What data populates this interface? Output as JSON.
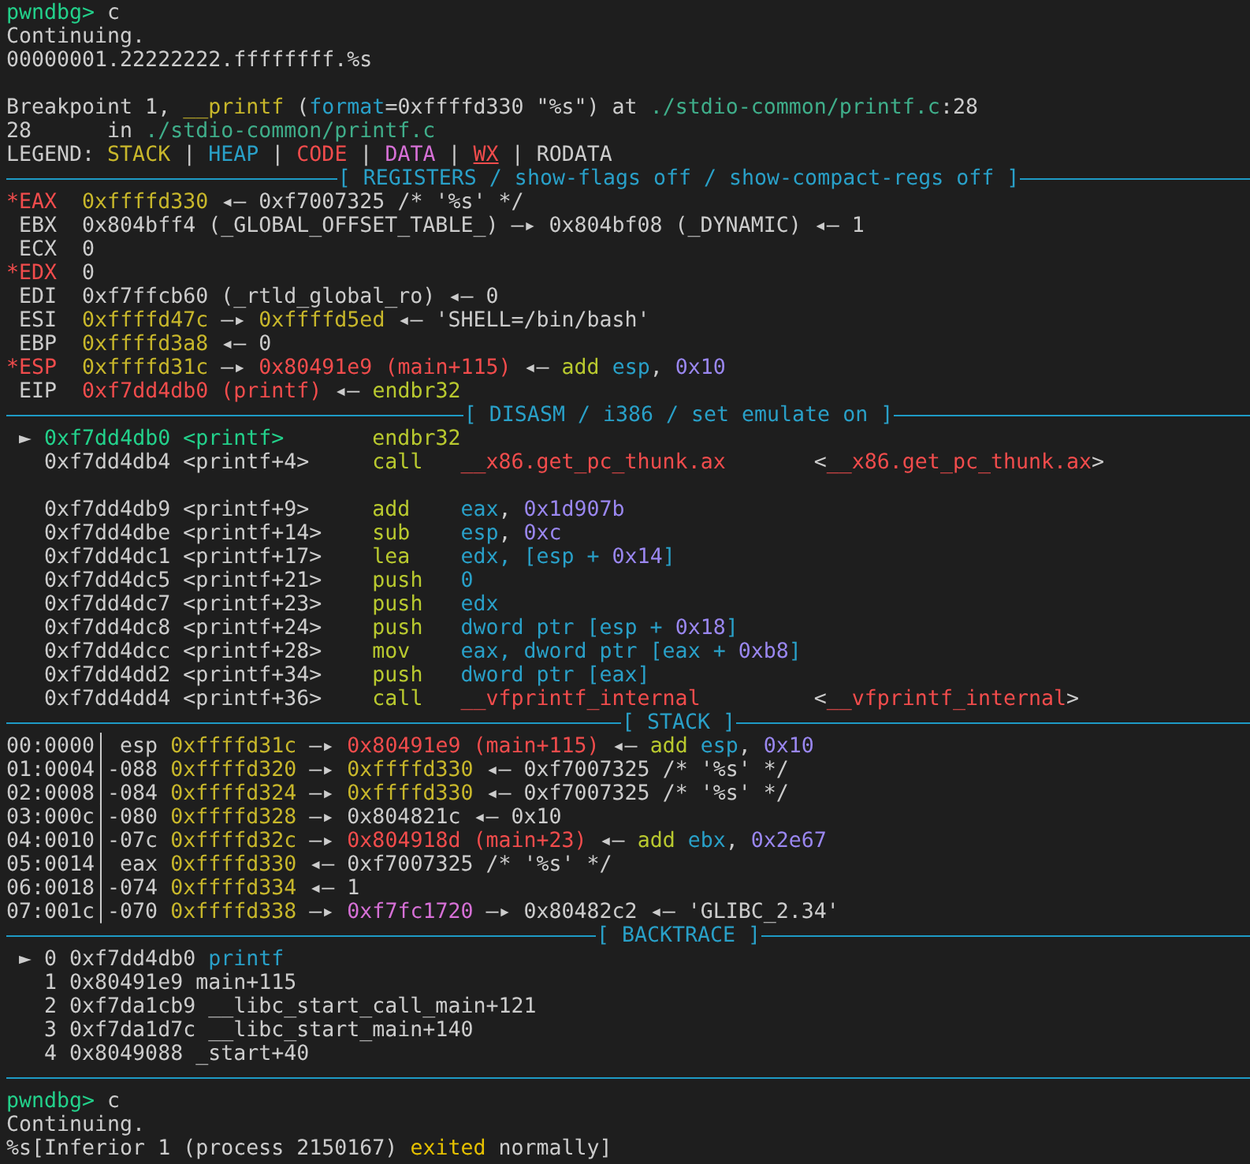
{
  "lines": [
    {
      "kind": "text",
      "segments": [
        {
          "text": "pwndbg>",
          "color": "#23d18b"
        },
        {
          "text": " c",
          "color": "#cccccc"
        }
      ]
    },
    {
      "kind": "text",
      "segments": [
        {
          "text": "Continuing.",
          "color": "#cccccc"
        }
      ]
    },
    {
      "kind": "text",
      "segments": [
        {
          "text": "00000001.22222222.ffffffff.%s",
          "color": "#cccccc"
        }
      ]
    },
    {
      "kind": "blank"
    },
    {
      "kind": "text",
      "segments": [
        {
          "text": "Breakpoint 1, ",
          "color": "#cccccc"
        },
        {
          "text": "__printf",
          "color": "#c8b72b"
        },
        {
          "text": " (",
          "color": "#cccccc"
        },
        {
          "text": "format",
          "color": "#29a0c8"
        },
        {
          "text": "=0xffffd330 \"%s\") at ",
          "color": "#cccccc"
        },
        {
          "text": "./stdio-common/printf.c",
          "color": "#3fae8a"
        },
        {
          "text": ":28",
          "color": "#cccccc"
        }
      ]
    },
    {
      "kind": "text",
      "segments": [
        {
          "text": "28      in ",
          "color": "#cccccc"
        },
        {
          "text": "./stdio-common/printf.c",
          "color": "#3fae8a"
        }
      ]
    },
    {
      "kind": "text",
      "segments": [
        {
          "text": "LEGEND: ",
          "color": "#cccccc"
        },
        {
          "text": "STACK",
          "color": "#c8b72b"
        },
        {
          "text": " | ",
          "color": "#cccccc"
        },
        {
          "text": "HEAP",
          "color": "#29a0c8"
        },
        {
          "text": " | ",
          "color": "#cccccc"
        },
        {
          "text": "CODE",
          "color": "#f14c4c"
        },
        {
          "text": " | ",
          "color": "#cccccc"
        },
        {
          "text": "DATA",
          "color": "#d670d6"
        },
        {
          "text": " | ",
          "color": "#cccccc"
        },
        {
          "text": "WX",
          "color": "#f14c4c",
          "underline": true
        },
        {
          "text": " | ",
          "color": "#cccccc"
        },
        {
          "text": "RODATA",
          "color": "#cccccc"
        }
      ]
    },
    {
      "kind": "rule",
      "title": "[ REGISTERS / show-flags off / show-compact-regs off ]"
    },
    {
      "kind": "text",
      "segments": [
        {
          "text": "*EAX  ",
          "color": "#f14c4c"
        },
        {
          "text": "0xffffd330",
          "color": "#c8b72b"
        },
        {
          "text": " ◂— 0xf7007325 /* '%s' */",
          "color": "#cccccc"
        }
      ]
    },
    {
      "kind": "text",
      "segments": [
        {
          "text": " EBX  0x804bff4 (_GLOBAL_OFFSET_TABLE_) —▸ 0x804bf08 (_DYNAMIC) ◂— 1",
          "color": "#cccccc"
        }
      ]
    },
    {
      "kind": "text",
      "segments": [
        {
          "text": " ECX  0",
          "color": "#cccccc"
        }
      ]
    },
    {
      "kind": "text",
      "segments": [
        {
          "text": "*EDX",
          "color": "#f14c4c"
        },
        {
          "text": "  0",
          "color": "#cccccc"
        }
      ]
    },
    {
      "kind": "text",
      "segments": [
        {
          "text": " EDI  0xf7ffcb60 (_rtld_global_ro) ◂— 0",
          "color": "#cccccc"
        }
      ]
    },
    {
      "kind": "text",
      "segments": [
        {
          "text": " ESI  ",
          "color": "#cccccc"
        },
        {
          "text": "0xffffd47c",
          "color": "#c8b72b"
        },
        {
          "text": " —▸ ",
          "color": "#cccccc"
        },
        {
          "text": "0xffffd5ed",
          "color": "#c8b72b"
        },
        {
          "text": " ◂— 'SHELL=/bin/bash'",
          "color": "#cccccc"
        }
      ]
    },
    {
      "kind": "text",
      "segments": [
        {
          "text": " EBP  ",
          "color": "#cccccc"
        },
        {
          "text": "0xffffd3a8",
          "color": "#c8b72b"
        },
        {
          "text": " ◂— 0",
          "color": "#cccccc"
        }
      ]
    },
    {
      "kind": "text",
      "segments": [
        {
          "text": "*ESP  ",
          "color": "#f14c4c"
        },
        {
          "text": "0xffffd31c",
          "color": "#c8b72b"
        },
        {
          "text": " —▸ ",
          "color": "#cccccc"
        },
        {
          "text": "0x80491e9 (main+115)",
          "color": "#f14c4c"
        },
        {
          "text": " ◂— ",
          "color": "#cccccc"
        },
        {
          "text": "add",
          "color": "#b9c92f"
        },
        {
          "text": " esp",
          "color": "#29a0c8"
        },
        {
          "text": ", ",
          "color": "#cccccc"
        },
        {
          "text": "0x10",
          "color": "#9a87f0"
        }
      ]
    },
    {
      "kind": "text",
      "segments": [
        {
          "text": " EIP  ",
          "color": "#cccccc"
        },
        {
          "text": "0xf7dd4db0 (printf)",
          "color": "#f14c4c"
        },
        {
          "text": " ◂— ",
          "color": "#cccccc"
        },
        {
          "text": "endbr32",
          "color": "#b9c92f"
        }
      ]
    },
    {
      "kind": "rule",
      "title": "[ DISASM / i386 / set emulate on ]"
    },
    {
      "kind": "text",
      "segments": [
        {
          "text": " ► ",
          "color": "#cccccc"
        },
        {
          "text": "0xf7dd4db0 <printf>       ",
          "color": "#23d18b"
        },
        {
          "text": "endbr32",
          "color": "#b9c92f"
        }
      ]
    },
    {
      "kind": "text",
      "segments": [
        {
          "text": "   0xf7dd4db4 <printf+4>     ",
          "color": "#cccccc"
        },
        {
          "text": "call   ",
          "color": "#b9c92f"
        },
        {
          "text": "__x86.get_pc_thunk.ax",
          "color": "#f14c4c"
        },
        {
          "text": "       <",
          "color": "#cccccc"
        },
        {
          "text": "__x86.get_pc_thunk.ax",
          "color": "#f14c4c"
        },
        {
          "text": ">",
          "color": "#cccccc"
        }
      ]
    },
    {
      "kind": "blank"
    },
    {
      "kind": "text",
      "segments": [
        {
          "text": "   0xf7dd4db9 <printf+9>     ",
          "color": "#cccccc"
        },
        {
          "text": "add    ",
          "color": "#b9c92f"
        },
        {
          "text": "eax",
          "color": "#29a0c8"
        },
        {
          "text": ", ",
          "color": "#cccccc"
        },
        {
          "text": "0x1d907b",
          "color": "#9a87f0"
        }
      ]
    },
    {
      "kind": "text",
      "segments": [
        {
          "text": "   0xf7dd4dbe <printf+14>    ",
          "color": "#cccccc"
        },
        {
          "text": "sub    ",
          "color": "#b9c92f"
        },
        {
          "text": "esp",
          "color": "#29a0c8"
        },
        {
          "text": ", ",
          "color": "#cccccc"
        },
        {
          "text": "0xc",
          "color": "#9a87f0"
        }
      ]
    },
    {
      "kind": "text",
      "segments": [
        {
          "text": "   0xf7dd4dc1 <printf+17>    ",
          "color": "#cccccc"
        },
        {
          "text": "lea    ",
          "color": "#b9c92f"
        },
        {
          "text": "edx, [esp + ",
          "color": "#29a0c8"
        },
        {
          "text": "0x14",
          "color": "#9a87f0"
        },
        {
          "text": "]",
          "color": "#29a0c8"
        }
      ]
    },
    {
      "kind": "text",
      "segments": [
        {
          "text": "   0xf7dd4dc5 <printf+21>    ",
          "color": "#cccccc"
        },
        {
          "text": "push   ",
          "color": "#b9c92f"
        },
        {
          "text": "0",
          "color": "#29a0c8"
        }
      ]
    },
    {
      "kind": "text",
      "segments": [
        {
          "text": "   0xf7dd4dc7 <printf+23>    ",
          "color": "#cccccc"
        },
        {
          "text": "push   ",
          "color": "#b9c92f"
        },
        {
          "text": "edx",
          "color": "#29a0c8"
        }
      ]
    },
    {
      "kind": "text",
      "segments": [
        {
          "text": "   0xf7dd4dc8 <printf+24>    ",
          "color": "#cccccc"
        },
        {
          "text": "push   ",
          "color": "#b9c92f"
        },
        {
          "text": "dword ptr [esp + ",
          "color": "#29a0c8"
        },
        {
          "text": "0x18",
          "color": "#9a87f0"
        },
        {
          "text": "]",
          "color": "#29a0c8"
        }
      ]
    },
    {
      "kind": "text",
      "segments": [
        {
          "text": "   0xf7dd4dcc <printf+28>    ",
          "color": "#cccccc"
        },
        {
          "text": "mov    ",
          "color": "#b9c92f"
        },
        {
          "text": "eax, dword ptr [eax + ",
          "color": "#29a0c8"
        },
        {
          "text": "0xb8",
          "color": "#9a87f0"
        },
        {
          "text": "]",
          "color": "#29a0c8"
        }
      ]
    },
    {
      "kind": "text",
      "segments": [
        {
          "text": "   0xf7dd4dd2 <printf+34>    ",
          "color": "#cccccc"
        },
        {
          "text": "push   ",
          "color": "#b9c92f"
        },
        {
          "text": "dword ptr [eax]",
          "color": "#29a0c8"
        }
      ]
    },
    {
      "kind": "text",
      "segments": [
        {
          "text": "   0xf7dd4dd4 <printf+36>    ",
          "color": "#cccccc"
        },
        {
          "text": "call   ",
          "color": "#b9c92f"
        },
        {
          "text": "__vfprintf_internal",
          "color": "#f14c4c"
        },
        {
          "text": "         <",
          "color": "#cccccc"
        },
        {
          "text": "__vfprintf_internal",
          "color": "#f14c4c"
        },
        {
          "text": ">",
          "color": "#cccccc"
        }
      ]
    },
    {
      "kind": "rule",
      "title": "[ STACK ]"
    },
    {
      "kind": "text",
      "segments": [
        {
          "text": "00:0000│ esp ",
          "color": "#cccccc"
        },
        {
          "text": "0xffffd31c",
          "color": "#c8b72b"
        },
        {
          "text": " —▸ ",
          "color": "#cccccc"
        },
        {
          "text": "0x80491e9 (main+115)",
          "color": "#f14c4c"
        },
        {
          "text": " ◂— ",
          "color": "#cccccc"
        },
        {
          "text": "add",
          "color": "#b9c92f"
        },
        {
          "text": " esp",
          "color": "#29a0c8"
        },
        {
          "text": ", ",
          "color": "#cccccc"
        },
        {
          "text": "0x10",
          "color": "#9a87f0"
        }
      ]
    },
    {
      "kind": "text",
      "segments": [
        {
          "text": "01:0004│-088 ",
          "color": "#cccccc"
        },
        {
          "text": "0xffffd320",
          "color": "#c8b72b"
        },
        {
          "text": " —▸ ",
          "color": "#cccccc"
        },
        {
          "text": "0xffffd330",
          "color": "#c8b72b"
        },
        {
          "text": " ◂— 0xf7007325 /* '%s' */",
          "color": "#cccccc"
        }
      ]
    },
    {
      "kind": "text",
      "segments": [
        {
          "text": "02:0008│-084 ",
          "color": "#cccccc"
        },
        {
          "text": "0xffffd324",
          "color": "#c8b72b"
        },
        {
          "text": " —▸ ",
          "color": "#cccccc"
        },
        {
          "text": "0xffffd330",
          "color": "#c8b72b"
        },
        {
          "text": " ◂— 0xf7007325 /* '%s' */",
          "color": "#cccccc"
        }
      ]
    },
    {
      "kind": "text",
      "segments": [
        {
          "text": "03:000c│-080 ",
          "color": "#cccccc"
        },
        {
          "text": "0xffffd328",
          "color": "#c8b72b"
        },
        {
          "text": " —▸ 0x804821c ◂— 0x10",
          "color": "#cccccc"
        }
      ]
    },
    {
      "kind": "text",
      "segments": [
        {
          "text": "04:0010│-07c ",
          "color": "#cccccc"
        },
        {
          "text": "0xffffd32c",
          "color": "#c8b72b"
        },
        {
          "text": " —▸ ",
          "color": "#cccccc"
        },
        {
          "text": "0x804918d (main+23)",
          "color": "#f14c4c"
        },
        {
          "text": " ◂— ",
          "color": "#cccccc"
        },
        {
          "text": "add",
          "color": "#b9c92f"
        },
        {
          "text": " ebx",
          "color": "#29a0c8"
        },
        {
          "text": ", ",
          "color": "#cccccc"
        },
        {
          "text": "0x2e67",
          "color": "#9a87f0"
        }
      ]
    },
    {
      "kind": "text",
      "segments": [
        {
          "text": "05:0014│ eax ",
          "color": "#cccccc"
        },
        {
          "text": "0xffffd330",
          "color": "#c8b72b"
        },
        {
          "text": " ◂— 0xf7007325 /* '%s' */",
          "color": "#cccccc"
        }
      ]
    },
    {
      "kind": "text",
      "segments": [
        {
          "text": "06:0018│-074 ",
          "color": "#cccccc"
        },
        {
          "text": "0xffffd334",
          "color": "#c8b72b"
        },
        {
          "text": " ◂— 1",
          "color": "#cccccc"
        }
      ]
    },
    {
      "kind": "text",
      "segments": [
        {
          "text": "07:001c│-070 ",
          "color": "#cccccc"
        },
        {
          "text": "0xffffd338",
          "color": "#c8b72b"
        },
        {
          "text": " —▸ ",
          "color": "#cccccc"
        },
        {
          "text": "0xf7fc1720",
          "color": "#d670d6"
        },
        {
          "text": " —▸ 0x80482c2 ◂— 'GLIBC_2.34'",
          "color": "#cccccc"
        }
      ]
    },
    {
      "kind": "rule",
      "title": "[ BACKTRACE ]"
    },
    {
      "kind": "text",
      "segments": [
        {
          "text": " ► 0 0xf7dd4db0 ",
          "color": "#cccccc"
        },
        {
          "text": "printf",
          "color": "#29a0c8"
        }
      ]
    },
    {
      "kind": "text",
      "segments": [
        {
          "text": "   1 0x80491e9 main+115",
          "color": "#cccccc"
        }
      ]
    },
    {
      "kind": "text",
      "segments": [
        {
          "text": "   2 0xf7da1cb9 __libc_start_call_main+121",
          "color": "#cccccc"
        }
      ]
    },
    {
      "kind": "text",
      "segments": [
        {
          "text": "   3 0xf7da1d7c __libc_start_main+140",
          "color": "#cccccc"
        }
      ]
    },
    {
      "kind": "text",
      "segments": [
        {
          "text": "   4 0x8049088 _start+40",
          "color": "#cccccc"
        }
      ]
    },
    {
      "kind": "rule"
    },
    {
      "kind": "text",
      "segments": [
        {
          "text": "pwndbg>",
          "color": "#23d18b"
        },
        {
          "text": " c",
          "color": "#cccccc"
        }
      ]
    },
    {
      "kind": "text",
      "segments": [
        {
          "text": "Continuing.",
          "color": "#cccccc"
        }
      ]
    },
    {
      "kind": "text",
      "segments": [
        {
          "text": "%s[Inferior 1 (process 2150167) ",
          "color": "#cccccc"
        },
        {
          "text": "exited",
          "color": "#e5c000"
        },
        {
          "text": " normally]",
          "color": "#cccccc"
        }
      ]
    }
  ]
}
